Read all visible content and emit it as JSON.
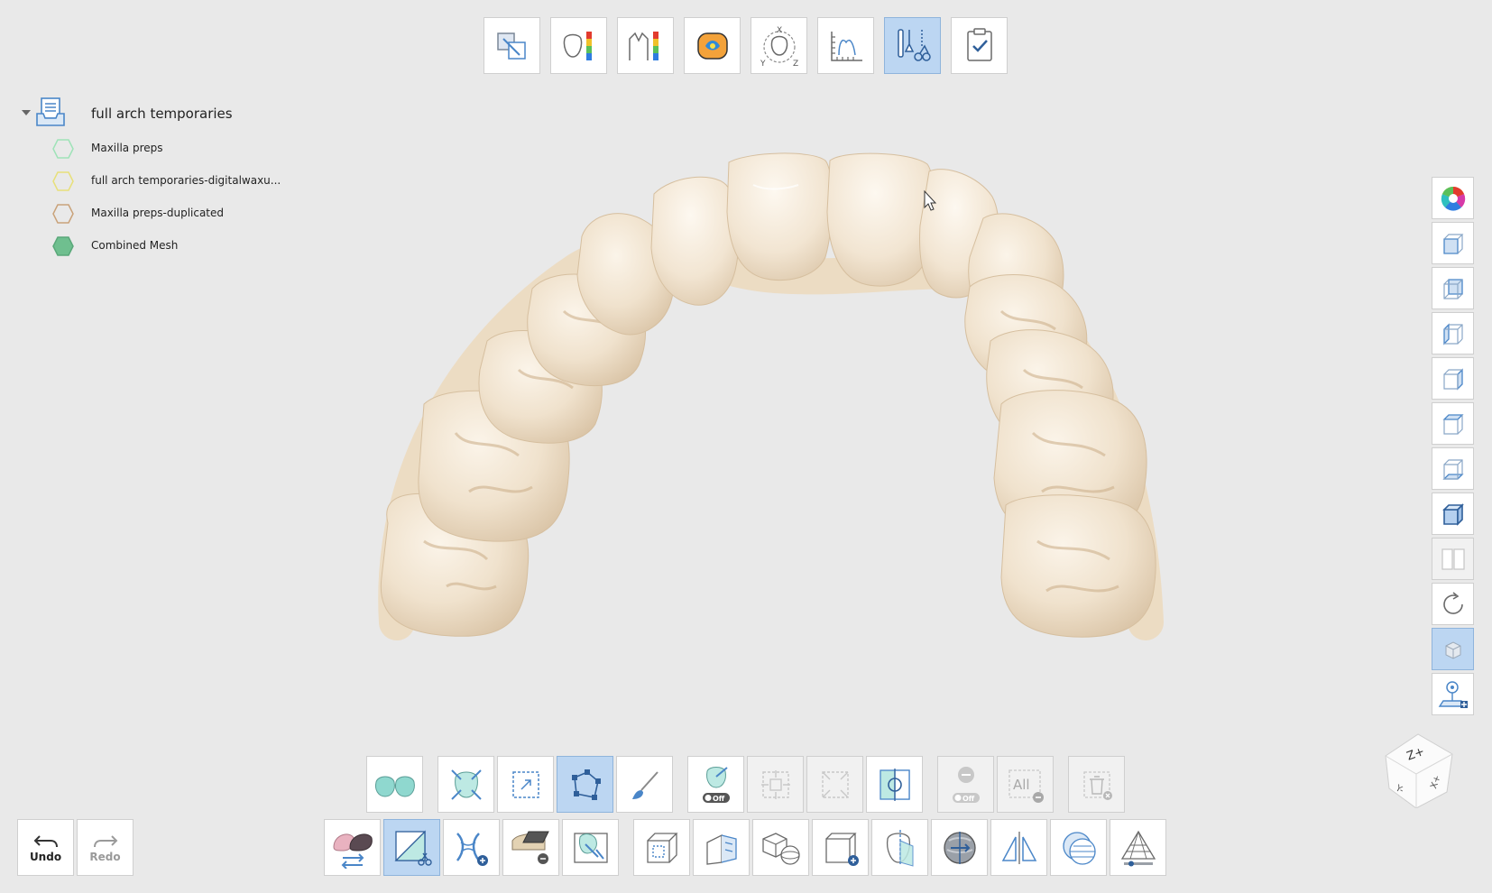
{
  "top_toolbar": {
    "tools": [
      {
        "icon": "alignment-icon",
        "active": false
      },
      {
        "icon": "tooth-thickness-map-icon",
        "active": false
      },
      {
        "icon": "cross-section-deviation-icon",
        "active": false
      },
      {
        "icon": "occlusion-map-icon",
        "active": false
      },
      {
        "icon": "xyz-rotation-icon",
        "active": false
      },
      {
        "icon": "measure-icon",
        "active": false
      },
      {
        "icon": "mesh-edit-tools-icon",
        "active": true
      },
      {
        "icon": "complete-checklist-icon",
        "active": false
      }
    ]
  },
  "tree": {
    "project_title": "full arch temporaries",
    "items": [
      {
        "label": "Maxilla preps",
        "color": "#9fe3b8",
        "filled": false
      },
      {
        "label": "full arch temporaries-digitalwaxu...",
        "color": "#e8e07a",
        "filled": false
      },
      {
        "label": "Maxilla preps-duplicated",
        "color": "#c9a27a",
        "filled": false
      },
      {
        "label": "Combined Mesh",
        "color": "#6fbf8f",
        "filled": true
      }
    ]
  },
  "right_toolbar": {
    "tools": [
      {
        "icon": "color-wheel-icon"
      },
      {
        "icon": "view-front-cube-icon"
      },
      {
        "icon": "view-back-cube-icon"
      },
      {
        "icon": "view-left-cube-icon"
      },
      {
        "icon": "view-right-cube-icon"
      },
      {
        "icon": "view-top-cube-icon"
      },
      {
        "icon": "view-bottom-cube-icon"
      },
      {
        "icon": "view-solid-cube-icon"
      },
      {
        "icon": "split-view-icon"
      },
      {
        "icon": "reset-rotate-icon"
      },
      {
        "icon": "render-mode-icon"
      },
      {
        "icon": "camera-view-icon"
      }
    ]
  },
  "bottom_row1": {
    "tools": [
      {
        "icon": "show-both-meshes-icon",
        "state": "normal"
      },
      {
        "icon": "fit-to-view-icon",
        "state": "normal"
      },
      {
        "icon": "rectangle-select-icon",
        "state": "normal"
      },
      {
        "icon": "polygon-select-icon",
        "state": "active"
      },
      {
        "icon": "brush-select-icon",
        "state": "normal"
      },
      {
        "icon": "through-select-off-icon",
        "state": "normal",
        "badge": "Off"
      },
      {
        "icon": "expand-selection-icon",
        "state": "disabled"
      },
      {
        "icon": "shrink-selection-icon",
        "state": "disabled"
      },
      {
        "icon": "invert-selection-icon",
        "state": "normal"
      },
      {
        "icon": "deselect-off-icon",
        "state": "disabled",
        "badge": "Off"
      },
      {
        "icon": "deselect-all-icon",
        "state": "disabled",
        "text": "All"
      },
      {
        "icon": "delete-selection-icon",
        "state": "disabled"
      }
    ]
  },
  "bottom_row2": {
    "tools": [
      {
        "icon": "switch-mesh-icon",
        "state": "normal"
      },
      {
        "icon": "cut-mesh-icon",
        "state": "active"
      },
      {
        "icon": "add-bridge-icon",
        "state": "normal"
      },
      {
        "icon": "smooth-surface-icon",
        "state": "normal"
      },
      {
        "icon": "sculpt-icon",
        "state": "normal"
      },
      {
        "icon": "box-cube-icon",
        "state": "normal"
      },
      {
        "icon": "extrude-surface-icon",
        "state": "normal"
      },
      {
        "icon": "add-primitive-icon",
        "state": "normal"
      },
      {
        "icon": "add-box-icon",
        "state": "normal"
      },
      {
        "icon": "plane-cut-icon",
        "state": "normal"
      },
      {
        "icon": "offset-icon",
        "state": "normal"
      },
      {
        "icon": "mirror-icon",
        "state": "normal"
      },
      {
        "icon": "sphere-icon",
        "state": "normal"
      },
      {
        "icon": "remesh-icon",
        "state": "normal"
      }
    ]
  },
  "undo": {
    "label": "Undo"
  },
  "redo": {
    "label": "Redo"
  },
  "view_cube": {
    "labels": [
      "Z+",
      "X+",
      "Y-"
    ]
  },
  "colors": {
    "accent": "#4a86c8",
    "active_bg": "#bcd6f2",
    "tooth": "#f1e6d4",
    "tooth_shade": "#d8c3a6",
    "background": "#e9e9e9"
  }
}
